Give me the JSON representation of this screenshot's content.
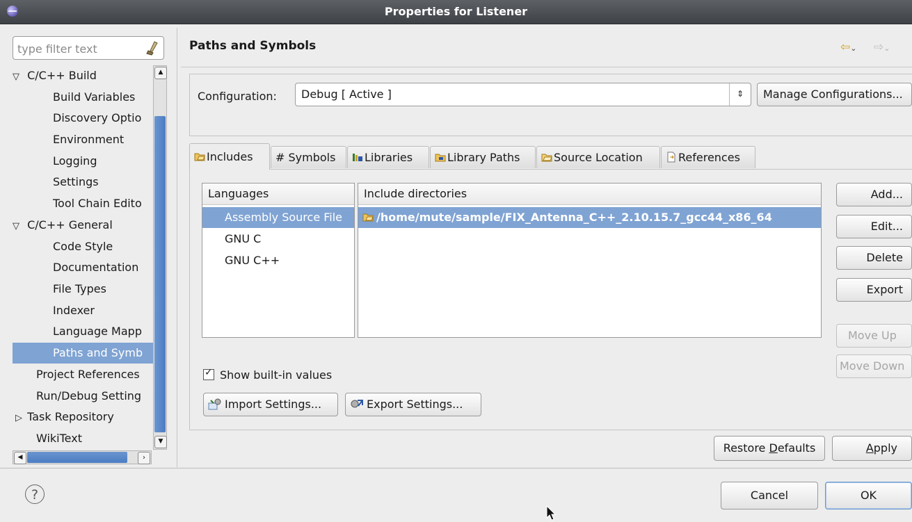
{
  "window": {
    "title": "Properties for Listener"
  },
  "filter": {
    "placeholder": "type filter text"
  },
  "tree": {
    "build": "C/C++ Build",
    "build_variables": "Build Variables",
    "discovery": "Discovery Optio",
    "environment": "Environment",
    "logging": "Logging",
    "settings": "Settings",
    "toolchain": "Tool Chain Edito",
    "general": "C/C++ General",
    "code_style": "Code Style",
    "documentation": "Documentation",
    "file_types": "File Types",
    "indexer": "Indexer",
    "language_mapp": "Language Mapp",
    "paths_symb": "Paths and Symb",
    "project_refs": "Project References",
    "run_debug": "Run/Debug Setting",
    "task_repo": "Task Repository",
    "wikitext": "WikiText"
  },
  "page": {
    "title": "Paths and Symbols"
  },
  "configuration": {
    "label": "Configuration:",
    "value": "Debug  [ Active ]",
    "manage_label": "Manage Configurations..."
  },
  "tabs": {
    "includes": "Includes",
    "symbols": "# Symbols",
    "libraries": "Libraries",
    "library_paths": "Library Paths",
    "source_location": "Source Location",
    "references": "References"
  },
  "languages": {
    "header": "Languages",
    "asm": "Assembly Source File",
    "gnu_c": "GNU C",
    "gnu_cpp": "GNU C++"
  },
  "includes": {
    "header": "Include directories",
    "path": "/home/mute/sample/FIX_Antenna_C++_2.10.15.7_gcc44_x86_64"
  },
  "buttons": {
    "add": "Add...",
    "edit": "Edit...",
    "delete": "Delete",
    "export": "Export",
    "move_up": "Move Up",
    "move_down": "Move Down",
    "import_settings": "Import Settings...",
    "export_settings": "Export Settings...",
    "restore_pre": "Restore ",
    "restore_mn": "D",
    "restore_post": "efaults",
    "apply_mn": "A",
    "apply_post": "pply",
    "cancel": "Cancel",
    "ok": "OK"
  },
  "show_builtin": {
    "label": "Show built-in values",
    "checked": true
  }
}
